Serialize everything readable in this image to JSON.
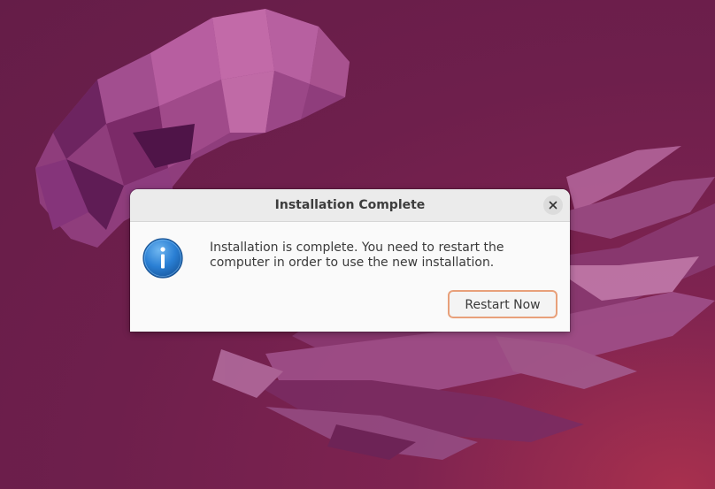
{
  "dialog": {
    "title": "Installation Complete",
    "message": "Installation is complete. You need to restart the computer in order to use the new installation.",
    "restart_label": "Restart Now"
  },
  "icons": {
    "close": "close-icon",
    "info": "info-icon"
  },
  "colors": {
    "wallpaper_base": "#6e1f4c",
    "wallpaper_accent": "#a8304e",
    "button_accent_border": "#e8a07a",
    "info_icon_blue": "#2a7fd4"
  }
}
